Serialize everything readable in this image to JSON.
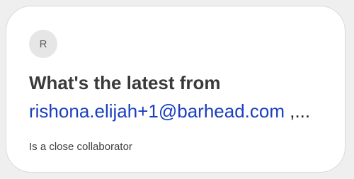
{
  "card": {
    "avatar_initial": "R",
    "headline_prefix": "What's the latest from",
    "email": "rishona.elijah+1@barhead.com",
    "email_suffix": " ,...",
    "subtext": "Is a close collaborator"
  },
  "colors": {
    "email_link": "#1a3fbf",
    "avatar_bg": "#e6e6e6",
    "card_bg": "#ffffff",
    "page_bg": "#efefef"
  }
}
